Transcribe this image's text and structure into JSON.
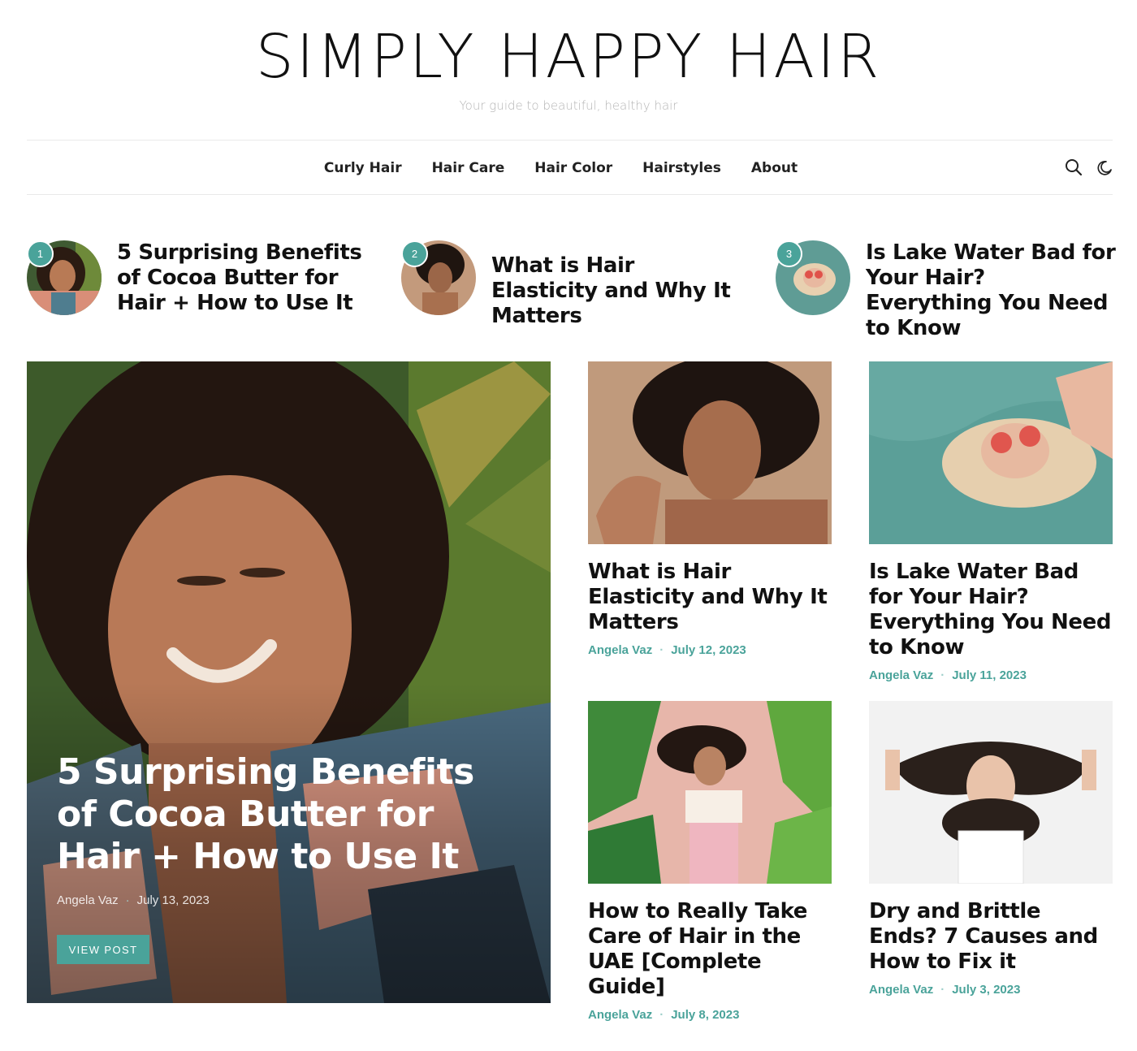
{
  "site": {
    "title": "SIMPLY HAPPY HAIR",
    "tagline": "Your guide to beautiful, healthy hair"
  },
  "nav": {
    "items": [
      "Curly Hair",
      "Hair Care",
      "Hair Color",
      "Hairstyles",
      "About"
    ],
    "icons": [
      "search-icon",
      "dark-mode-moon-icon"
    ]
  },
  "trending": [
    {
      "num": "1",
      "title": "5 Surprising Benefits of Cocoa Butter for Hair + How to Use It"
    },
    {
      "num": "2",
      "title": "What is Hair Elasticity and Why It Matters"
    },
    {
      "num": "3",
      "title": "Is Lake Water Bad for Your Hair? Everything You Need to Know"
    }
  ],
  "featured": {
    "title": "5 Surprising Benefits of Cocoa Butter for Hair + How to Use It",
    "author": "Angela Vaz",
    "date": "July 13, 2023",
    "button": "VIEW POST"
  },
  "posts": [
    {
      "title": "What is Hair Elasticity and Why It Matters",
      "author": "Angela Vaz",
      "date": "July 12, 2023"
    },
    {
      "title": "Is Lake Water Bad for Your Hair? Everything You Need to Know",
      "author": "Angela Vaz",
      "date": "July 11, 2023"
    },
    {
      "title": "How to Really Take Care of Hair in the UAE [Complete Guide]",
      "author": "Angela Vaz",
      "date": "July 8, 2023"
    },
    {
      "title": "Dry and Brittle Ends? 7 Causes and How to Fix it",
      "author": "Angela Vaz",
      "date": "July 3, 2023"
    }
  ],
  "meta_separator": "·",
  "colors": {
    "accent": "#4aa39a",
    "text": "#111111",
    "tagline": "#b5b5b5"
  }
}
